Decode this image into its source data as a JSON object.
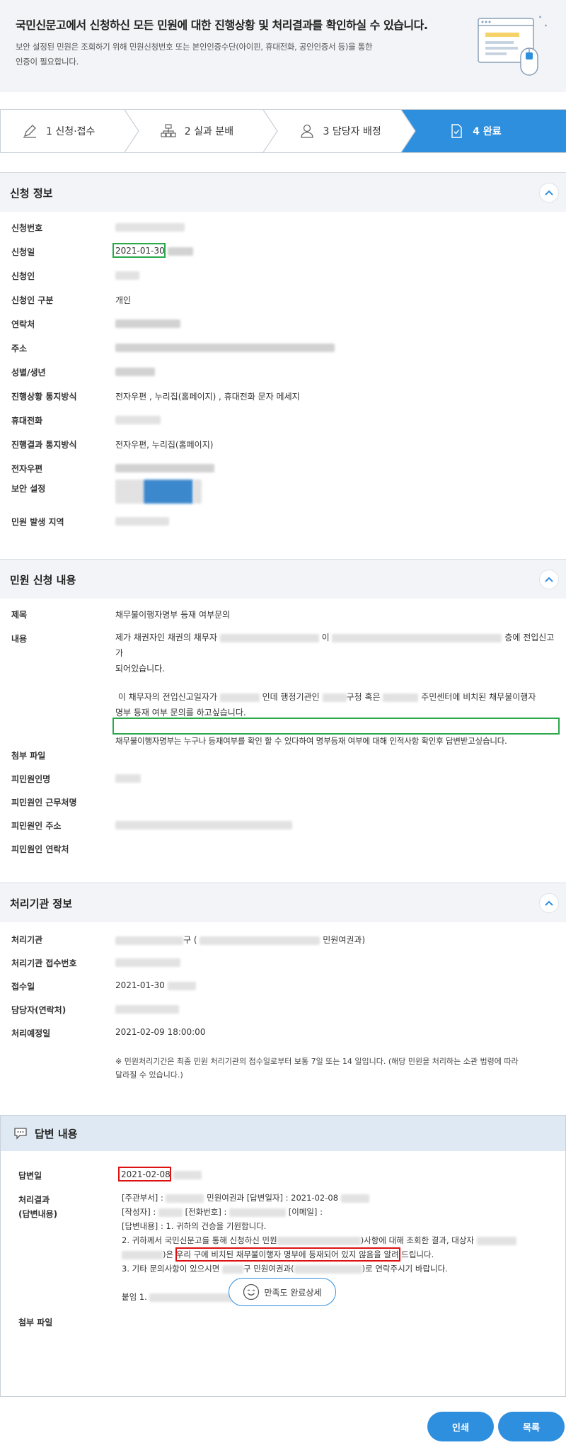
{
  "notice": {
    "title": "국민신문고에서 신청하신 모든 민원에 대한 진행상황 및 처리결과를 확인하실 수 있습니다.",
    "desc_line1": "보안 설정된 민원은 조회하기 위해 민원신청번호 또는 본인인증수단(아이핀, 휴대전화, 공인인증서 등)을 통한",
    "desc_line2": "인증이 필요합니다."
  },
  "steps": [
    {
      "label": "1 신청·접수",
      "icon": "pencil-icon"
    },
    {
      "label": "2 실과 분배",
      "icon": "org-chart-icon"
    },
    {
      "label": "3 담당자 배정",
      "icon": "person-icon"
    },
    {
      "label": "4 완료",
      "icon": "document-check-icon"
    }
  ],
  "application": {
    "section_title": "신청 정보",
    "labels": {
      "number": "신청번호",
      "date": "신청일",
      "applicant": "신청인",
      "type": "신청인 구분",
      "contact": "연락처",
      "address": "주소",
      "gender_birth": "성별/생년",
      "notify_method": "진행상황 통지방식",
      "mobile": "휴대전화",
      "result_notify": "진행결과 통지방식",
      "email": "전자우편",
      "security": "보안 설정",
      "region": "민원 발생 지역"
    },
    "values": {
      "date": "2021-01-30",
      "type": "개인",
      "notify_method": "전자우편 , 누리집(홈페이지) , 휴대전화 문자 메세지",
      "result_notify": "전자우편, 누리집(홈페이지)"
    }
  },
  "complaint": {
    "section_title": "민원 신청 내용",
    "labels": {
      "subject": "제목",
      "content": "내용",
      "attachment": "첨부 파일",
      "target_name": "피민원인명",
      "target_work": "피민원인 근무처명",
      "target_address": "피민원인 주소",
      "target_contact": "피민원인 연락처"
    },
    "subject": "채무불이행자명부 등재 여부문의",
    "content_l1a": "제가 채권자인 채권의 채무자",
    "content_l1b": "이",
    "content_l1c": "층에 전입신고가",
    "content_l2": "되어있습니다.",
    "content_l3a": "이 채무자의 전입신고일자가",
    "content_l3b": "인데 행정기관인",
    "content_l3c": "구청 혹은",
    "content_l3d": "주민센터에 비치된 채무불이행자",
    "content_l4": "명부 등재 여부 문의를 하고싶습니다.",
    "content_l5": "채무불이행자명부는 누구나 등재여부를 확인 할 수 있다하여 명부등재 여부에 대해 인적사항 확인후 답변받고싶습니다."
  },
  "agency": {
    "section_title": "처리기관 정보",
    "labels": {
      "agency": "처리기관",
      "receipt_no": "처리기관 접수번호",
      "receipt_date": "접수일",
      "manager": "담당자(연락처)",
      "due_date": "처리예정일"
    },
    "agency_suffix": "구 (",
    "agency_dept": "민원여권과)",
    "receipt_date": "2021-01-30",
    "due_date": "2021-02-09 18:00:00",
    "note_l1": "※ 민원처리기간은 최종 민원 처리기관의 접수일로부터 보통 7일 또는 14 일입니다. (해당 민원을 처리하는 소관 법령에 따라",
    "note_l2": "달라질 수 있습니다.)"
  },
  "answer": {
    "section_title": "답변 내용",
    "labels": {
      "date": "답변일",
      "result_l1": "처리결과",
      "result_l2": "(답변내용)",
      "attachment": "첨부 파일"
    },
    "date": "2021-02-08",
    "line1a": "[주관부서] :",
    "line1b": "민원여권과 [답변일자] : 2021-02-08",
    "line2a": "[작성자] :",
    "line2b": "[전화번호] :",
    "line2c": "[이메일] :",
    "line3": "[답변내용] : 1. 귀하의 건승을 기원합니다.",
    "line4a": "2. 귀하께서 국민신문고를 통해 신청하신 민원",
    "line4b": ")사항에 대해 조회한 결과, 대상자",
    "line5a": ")은",
    "line5b": "우리 구에 비치된 채무불이행자 명부에 등재되어 있지 않음",
    "line5c": "을 알려 드립니다.",
    "line6a": "3. 기타 문의사항이 있으시면",
    "line6b": "구 민원여권과(",
    "line6c": ")로 연락주시기 바랍니다.",
    "line7": "붙임 1.",
    "satisfaction_button": "만족도 완료상세"
  },
  "buttons": {
    "print": "인쇄",
    "list": "목록"
  },
  "colors": {
    "accent": "#2e8fde",
    "highlight_green": "#2aa84a",
    "highlight_red": "#dd1111"
  }
}
